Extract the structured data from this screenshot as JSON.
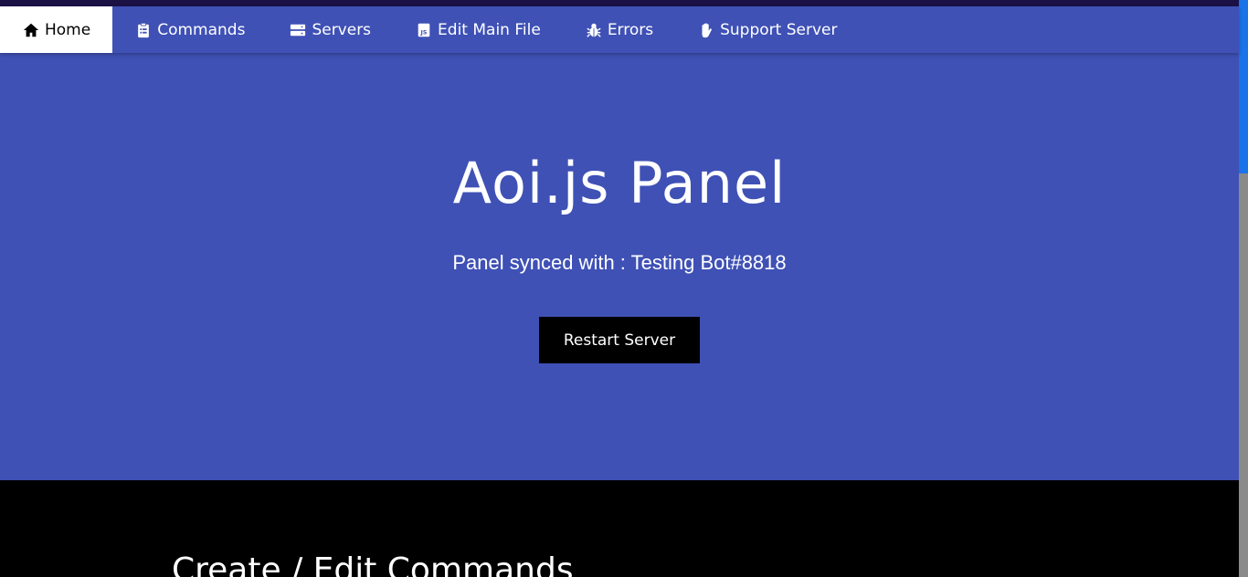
{
  "nav": {
    "items": [
      {
        "label": "Home",
        "icon": "home-icon"
      },
      {
        "label": "Commands",
        "icon": "clipboard-icon"
      },
      {
        "label": "Servers",
        "icon": "server-icon"
      },
      {
        "label": "Edit Main File",
        "icon": "js-file-icon"
      },
      {
        "label": "Errors",
        "icon": "bug-icon"
      },
      {
        "label": "Support Server",
        "icon": "hand-icon"
      }
    ],
    "active_index": 0
  },
  "hero": {
    "title": "Aoi.js Panel",
    "subtitle": "Panel synced with : Testing Bot#8818",
    "restart_label": "Restart Server"
  },
  "section": {
    "title": "Create / Edit Commands"
  },
  "colors": {
    "primary": "#3f51b5",
    "topline": "#1b1145",
    "button": "#000000",
    "scroll_thumb": "#1a73e8"
  }
}
